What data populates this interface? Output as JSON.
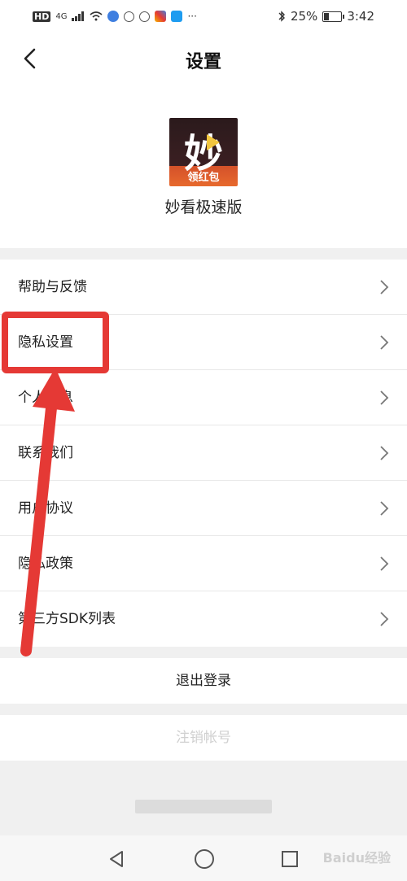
{
  "status_bar": {
    "left_labels": [
      "HD",
      "4G"
    ],
    "battery": "25%",
    "time": "3:42",
    "battery_level": 0.25
  },
  "header": {
    "title": "设置",
    "app_name": "妙看极速版",
    "logo_glyph": "妙",
    "logo_badge": "领红包"
  },
  "menu": {
    "items": [
      {
        "label": "帮助与反馈"
      },
      {
        "label": "隐私设置"
      },
      {
        "label": "个人信息"
      },
      {
        "label": "联系我们"
      },
      {
        "label": "用户协议"
      },
      {
        "label": "隐私政策"
      },
      {
        "label": "第三方SDK列表"
      }
    ]
  },
  "actions": {
    "logout_label": "退出登录",
    "cancel_account_label": "注销帐号"
  },
  "watermark": "Baidu经验",
  "colors": {
    "highlight": "#e53935",
    "background": "#f0f0f0"
  },
  "icons": {
    "back": "chevron-left-icon",
    "menu_arrow": "chevron-right-icon",
    "nav_back": "triangle-back-icon",
    "nav_home": "circle-home-icon",
    "nav_recent": "square-recent-icon"
  }
}
